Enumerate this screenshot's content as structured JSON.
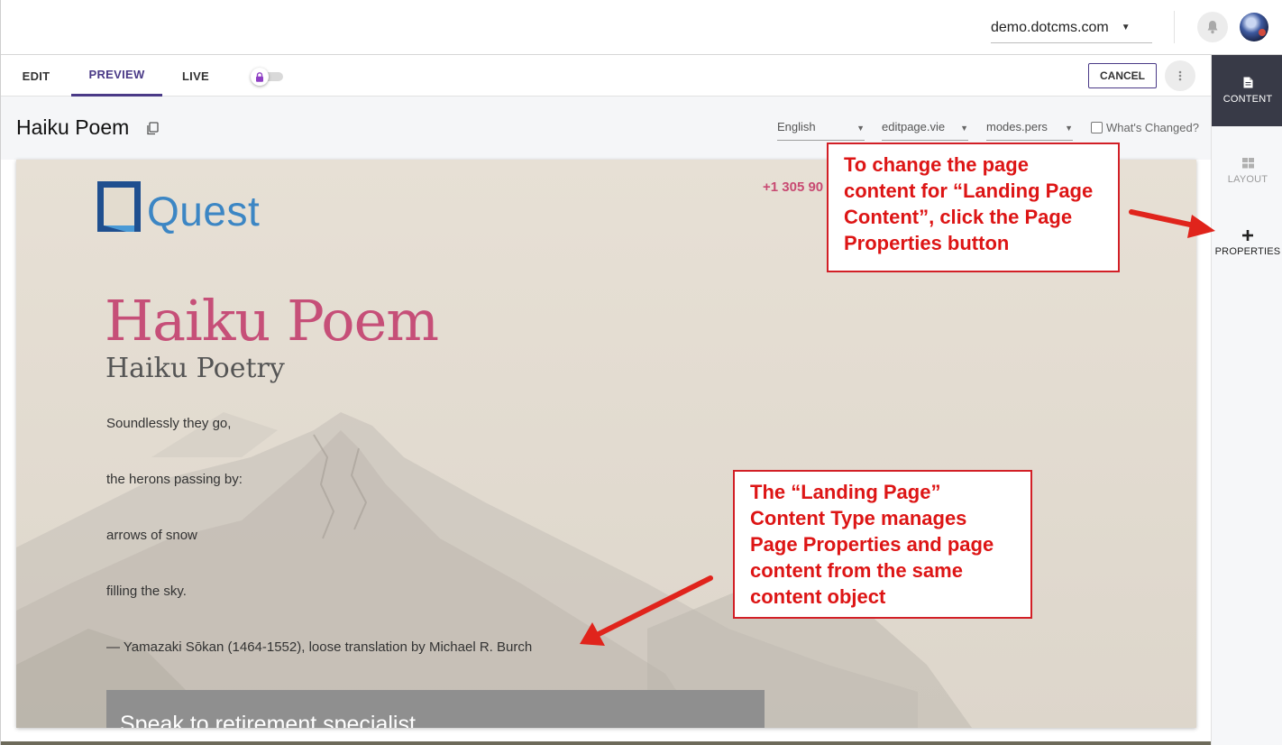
{
  "header": {
    "site_name": "demo.dotcms.com",
    "bell_icon": "bell-icon",
    "avatar": "user-avatar"
  },
  "mode_tabs": [
    {
      "label": "EDIT"
    },
    {
      "label": "PREVIEW",
      "active": true
    },
    {
      "label": "LIVE"
    }
  ],
  "lock_toggle": {
    "icon": "lock-icon",
    "locked": true
  },
  "actions": {
    "cancel_label": "CANCEL",
    "more_icon": "vertical-dots-icon"
  },
  "page_toolbar": {
    "title": "Haiku Poem",
    "copy_icon": "copy-icon",
    "language": "English",
    "device": "editpage.vie",
    "persona": "modes.pers",
    "whats_changed": "What's Changed?"
  },
  "preview": {
    "logo_text": "Quest",
    "phone": "+1 305 90",
    "hero_title": "Haiku Poem",
    "hero_subtitle": "Haiku Poetry",
    "poem_lines": [
      "Soundlessly they go,",
      "the herons passing by:",
      "arrows of snow",
      "filling the sky.",
      "— Yamazaki Sōkan (1464-1552), loose translation by Michael R. Burch"
    ],
    "cta_text": "Speak to retirement specialist"
  },
  "sidebar": {
    "items": [
      {
        "label": "CONTENT",
        "icon": "document-icon",
        "active": true
      },
      {
        "label": "LAYOUT",
        "icon": "grid-icon"
      },
      {
        "label": "PROPERTIES",
        "icon": "plus-icon"
      }
    ]
  },
  "annotations": {
    "top": "To change the page content for “Landing Page Content”, click the Page Properties button",
    "bottom": "The “Landing Page” Content Type manages Page Properties and page content from the same content object"
  },
  "colors": {
    "accent": "#4a3a87",
    "sidebar_active": "#383a47",
    "hero_pink": "#c64f78",
    "annotation_red": "#d21f26"
  }
}
